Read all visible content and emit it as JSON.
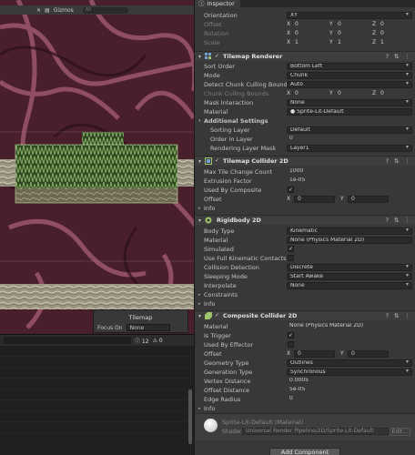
{
  "scene": {
    "gizmos_label": "Gizmos",
    "search_placeholder": "All",
    "overlay": {
      "title": "Tilemap",
      "focus_label": "Focus On",
      "focus_value": "None"
    }
  },
  "bottom_panel": {
    "count_label": "12",
    "count2_label": "0"
  },
  "inspector": {
    "tab_label": "Inspector",
    "transform_rows": [
      {
        "label": "Orientation",
        "value": "XY"
      },
      {
        "label": "Offset",
        "x": "0",
        "y": "0",
        "z": "0"
      },
      {
        "label": "Rotation",
        "x": "0",
        "y": "0",
        "z": "0"
      },
      {
        "label": "Scale",
        "x": "1",
        "y": "1",
        "z": "1"
      }
    ],
    "tilemap_renderer": {
      "title": "Tilemap Renderer",
      "rows": [
        {
          "label": "Sort Order",
          "value": "Bottom Left"
        },
        {
          "label": "Mode",
          "value": "Chunk"
        },
        {
          "label": "Detect Chunk Culling Bounds",
          "value": "Auto"
        },
        {
          "label": "Chunk Culling Bounds",
          "x": "0",
          "y": "0",
          "z": "0"
        },
        {
          "label": "Mask Interaction",
          "value": "None"
        },
        {
          "label": "Material",
          "value": "Sprite-Lit-Default"
        }
      ],
      "additional_settings": "Additional Settings",
      "sub_rows": [
        {
          "label": "Sorting Layer",
          "value": "Default"
        },
        {
          "label": "Order in Layer",
          "value": "0"
        },
        {
          "label": "Rendering Layer Mask",
          "value": "Layer1"
        }
      ]
    },
    "tilemap_collider": {
      "title": "Tilemap Collider 2D",
      "rows": [
        {
          "label": "Max Tile Change Count",
          "value": "1000"
        },
        {
          "label": "Extrusion Factor",
          "value": "1e-05"
        },
        {
          "label": "Used By Composite",
          "value": "✓"
        },
        {
          "label": "Offset",
          "x": "0",
          "y": "0"
        },
        {
          "label": "Info"
        }
      ]
    },
    "rigidbody": {
      "title": "Rigidbody 2D",
      "rows": [
        {
          "label": "Body Type",
          "value": "Kinematic"
        },
        {
          "label": "Material",
          "value": "None (Physics Material 2D)"
        },
        {
          "label": "Simulated",
          "value": "✓"
        },
        {
          "label": "Use Full Kinematic Contacts",
          "value": ""
        },
        {
          "label": "Collision Detection",
          "value": "Discrete"
        },
        {
          "label": "Sleeping Mode",
          "value": "Start Awake"
        },
        {
          "label": "Interpolate",
          "value": "None"
        },
        {
          "label": "Constraints"
        },
        {
          "label": "Info"
        }
      ]
    },
    "composite": {
      "title": "Composite Collider 2D",
      "rows": [
        {
          "label": "Material",
          "value": "None (Physics Material 2D)"
        },
        {
          "label": "Is Trigger",
          "value": "✓"
        },
        {
          "label": "Used By Effector",
          "value": ""
        },
        {
          "label": "Offset",
          "x": "0",
          "y": "0"
        },
        {
          "label": "Geometry Type",
          "value": "Outlines"
        },
        {
          "label": "Generation Type",
          "value": "Synchronous"
        },
        {
          "label": "Vertex Distance",
          "value": "0.0005"
        },
        {
          "label": "Offset Distance",
          "value": "5e-05"
        },
        {
          "label": "Edge Radius",
          "value": "0"
        },
        {
          "label": "Info"
        }
      ]
    },
    "material_preview": {
      "name": "Sprite-Lit-Default (Material)",
      "shader_label": "Shader",
      "shader_value": "Universal Render Pipeline/2D/Sprite-Lit-Default",
      "edit_label": "Edit..."
    },
    "add_component_label": "Add Component"
  },
  "colors": {
    "panel_bg": "#383838",
    "field_bg": "#2a2a2a",
    "scene_bg": "#5a2a3a",
    "tile_green": "#4a6b3a"
  }
}
